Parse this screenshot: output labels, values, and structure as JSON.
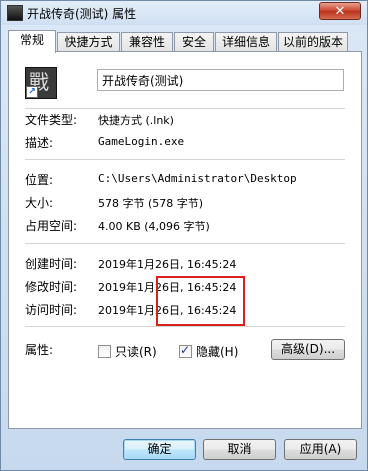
{
  "window": {
    "title": "开战传奇(测试) 属性",
    "close_label": "✕"
  },
  "tabs": [
    {
      "label": "常规",
      "active": true
    },
    {
      "label": "快捷方式",
      "active": false
    },
    {
      "label": "兼容性",
      "active": false
    },
    {
      "label": "安全",
      "active": false
    },
    {
      "label": "详细信息",
      "active": false
    },
    {
      "label": "以前的版本",
      "active": false
    }
  ],
  "general": {
    "icon_glyph": "戰",
    "name": "开战传奇(测试)",
    "file_type_label": "文件类型:",
    "file_type_value": "快捷方式 (.lnk)",
    "description_label": "描述:",
    "description_value": "GameLogin.exe",
    "location_label": "位置:",
    "location_value": "C:\\Users\\Administrator\\Desktop",
    "size_label": "大小:",
    "size_value": "578 字节 (578 字节)",
    "disk_size_label": "占用空间:",
    "disk_size_value": "4.00 KB (4,096 字节)",
    "created_label": "创建时间:",
    "created_value": "2019年1月26日, 16:45:24",
    "modified_label": "修改时间:",
    "modified_value": "2019年1月26日, 16:45:24",
    "accessed_label": "访问时间:",
    "accessed_value": "2019年1月26日, 16:45:24",
    "attributes_label": "属性:",
    "readonly_label": "只读(R)",
    "readonly_checked": false,
    "hidden_label": "隐藏(H)",
    "hidden_checked": true,
    "advanced_label": "高级(D)..."
  },
  "footer": {
    "ok_label": "确定",
    "cancel_label": "取消",
    "apply_label": "应用(A)"
  },
  "colors": {
    "highlight_border": "#d9201c",
    "window_frame": "#c7d9ee"
  }
}
